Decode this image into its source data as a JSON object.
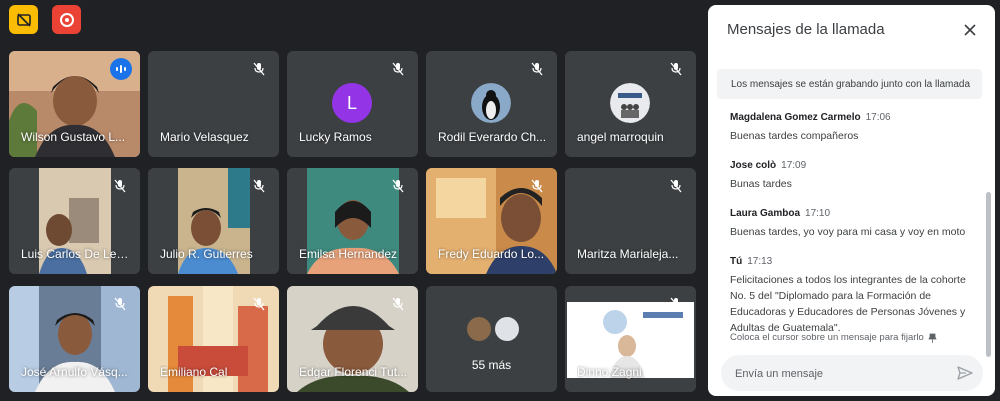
{
  "toolbar": {
    "captions_icon": "captions-off-icon",
    "record_icon": "recording-icon"
  },
  "participants": [
    {
      "name": "Wilson Gustavo L...",
      "speaking": true
    },
    {
      "name": "Mario Velasquez",
      "muted": true
    },
    {
      "name": "Lucky Ramos",
      "muted": true,
      "initial": "L",
      "avatar_color": "#9334e6"
    },
    {
      "name": "Rodil Everardo Ch...",
      "muted": true
    },
    {
      "name": "angel marroquin",
      "muted": true
    },
    {
      "name": "Luis Carlos De Leo...",
      "muted": true
    },
    {
      "name": "Julio R. Gutierres",
      "muted": true
    },
    {
      "name": "Emilsa Hernandez",
      "muted": true
    },
    {
      "name": "Fredy Eduardo Lo...",
      "muted": true
    },
    {
      "name": "Maritza Marialeja...",
      "muted": true
    },
    {
      "name": "José Arnulfo Vásq...",
      "muted": true
    },
    {
      "name": "Emiliano Cal",
      "muted": true
    },
    {
      "name": "Edgar Florenci Tut...",
      "muted": true
    },
    {
      "name": "Dinno Zagni",
      "muted": true
    }
  ],
  "more_tile": {
    "label": "55 más"
  },
  "chat": {
    "title": "Mensajes de la llamada",
    "recording_notice": "Los mensajes se están grabando junto con la llamada",
    "messages": [
      {
        "author": "Magdalena Gomez Carmelo",
        "time": "17:06",
        "text": "Buenas tardes compañeros"
      },
      {
        "author": "Jose colò",
        "time": "17:09",
        "text": "Bunas tardes"
      },
      {
        "author": "Laura Gamboa",
        "time": "17:10",
        "text": "Buenas tardes,  yo voy para mi casa y voy en moto"
      },
      {
        "author": "Tú",
        "time": "17:13",
        "text": "Felicitaciones a todos los integrantes de la cohorte No. 5 del \"Diplomado para la Formación de Educadoras y Educadores de Personas Jóvenes y Adultas de Guatemala\"."
      }
    ],
    "pin_hint": "Coloca el cursor sobre un mensaje para fijarlo",
    "input_placeholder": "Envía un mensaje"
  },
  "colors": {
    "background": "#202124",
    "tile": "#3c4043",
    "accent": "#1a73e8",
    "panel": "#ffffff"
  }
}
